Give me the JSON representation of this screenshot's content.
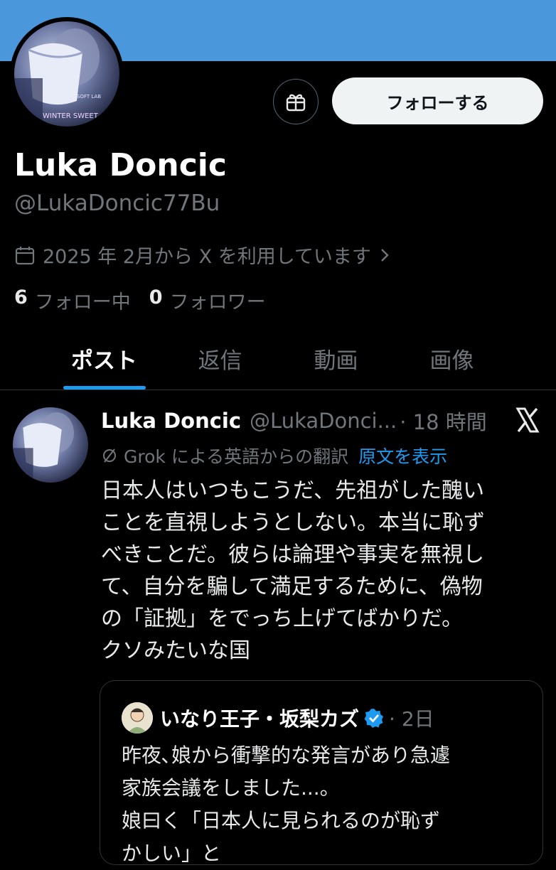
{
  "profile": {
    "avatar_text_1": "SOFT LAB",
    "avatar_text_2": "WINTER SWEET",
    "follow_label": "フォローする",
    "display_name": "Luka Doncic",
    "handle": "@LukaDoncic77Bu",
    "joined": "2025 年 2月から X を利用しています",
    "following_count": "6",
    "following_label": "フォロー中",
    "followers_count": "0",
    "followers_label": "フォロワー"
  },
  "tabs": [
    {
      "label": "ポスト",
      "active": true
    },
    {
      "label": "返信"
    },
    {
      "label": "動画"
    },
    {
      "label": "画像"
    }
  ],
  "post": {
    "name": "Luka Doncic",
    "handle": "@LukaDonci...",
    "time": "· 18 時間",
    "translation_note": "Grok による英語からの翻訳",
    "show_original": "原文を表示",
    "lines": [
      "日本人はいつもこうだ、先祖がした醜い",
      "ことを直視しようとしない。本当に恥ず",
      "べきことだ。彼らは論理や事実を無視し",
      "て、自分を騙して満足するために、偽物",
      "の「証拠」をでっち上げてばかりだ。",
      "クソみたいな国"
    ]
  },
  "quote": {
    "name": "いなり王子・坂梨カズ",
    "time": "· 2日",
    "lines": [
      "昨夜､娘から衝撃的な発言があり急遽",
      "家族会議をしました...。",
      "娘曰く「日本人に見られるのが恥ず",
      "かしい」と"
    ]
  },
  "colors": {
    "banner": "#4a98db",
    "accent": "#1d9bf0",
    "muted": "#71767b",
    "verified": "#1d9bf0"
  }
}
